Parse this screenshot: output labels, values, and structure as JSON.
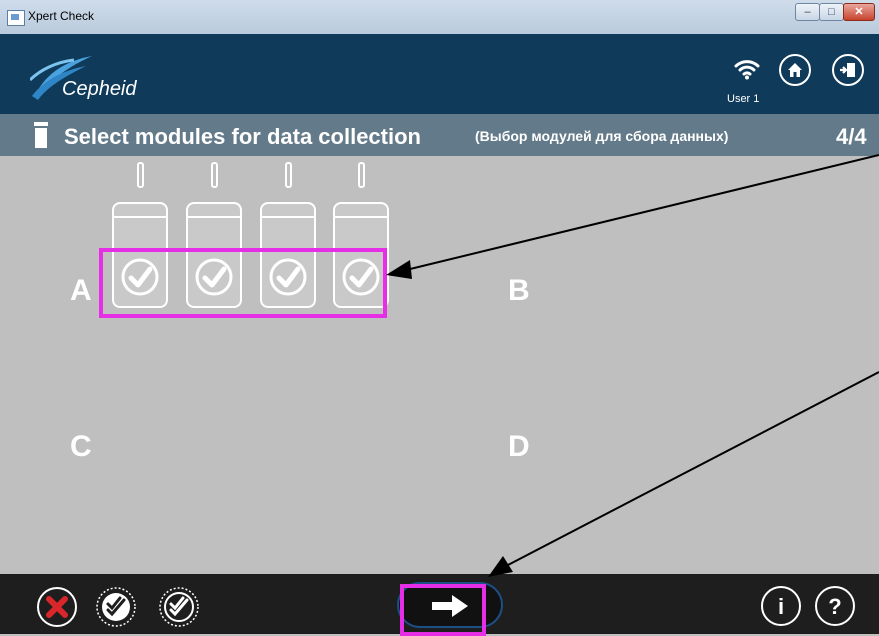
{
  "window": {
    "title": "Xpert Check",
    "controls": [
      "minimize",
      "maximize",
      "close"
    ]
  },
  "header": {
    "logo_text": "Cepheid",
    "user_label": "User 1",
    "icons": [
      "wifi-icon",
      "home-icon",
      "exit-icon"
    ]
  },
  "subheader": {
    "title": "Select modules for data collection",
    "subtitle": "(Выбор модулей для сбора данных)",
    "step": "4/4"
  },
  "quadrants": {
    "a": "A",
    "b": "B",
    "c": "C",
    "d": "D"
  },
  "modules": [
    {
      "selected": true
    },
    {
      "selected": true
    },
    {
      "selected": true
    },
    {
      "selected": true
    }
  ],
  "footer": {
    "left_buttons": [
      "cancel-icon",
      "select-all-icon",
      "deselect-all-icon"
    ],
    "next_icon": "arrow-right-icon",
    "right_buttons": [
      "info-icon",
      "help-icon"
    ],
    "info_label": "i",
    "help_label": "?"
  },
  "colors": {
    "header_bg": "#0f3a5a",
    "subheader_bg": "#637a8a",
    "content_bg": "#bfbfbf",
    "footer_bg": "#1e1e1e",
    "highlight": "#e62ee6",
    "cancel_red": "#d8262b"
  }
}
